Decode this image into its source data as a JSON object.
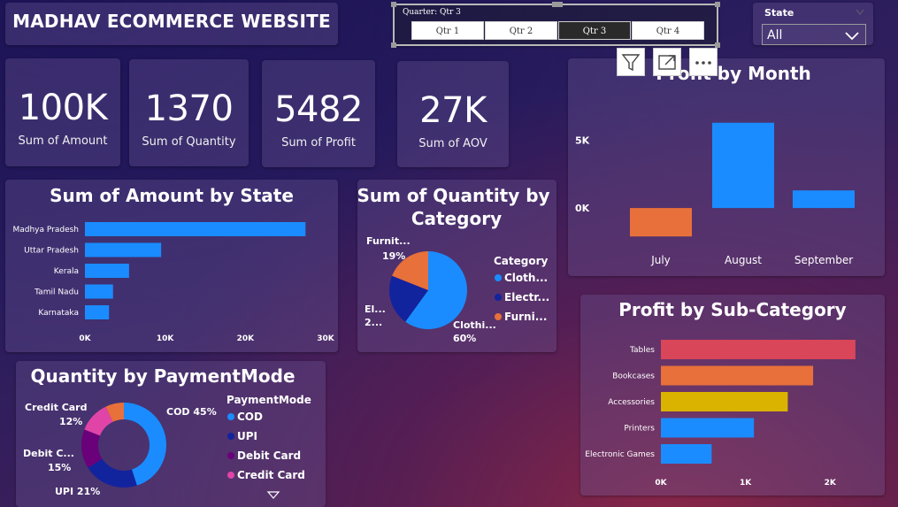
{
  "header": {
    "title": "MADHAV ECOMMERCE WEBSITE"
  },
  "quarter_slicer": {
    "label": "Quarter: Qtr 3",
    "options": [
      "Qtr 1",
      "Qtr 2",
      "Qtr 3",
      "Qtr 4"
    ],
    "selected": "Qtr 3"
  },
  "state_slicer": {
    "label": "State",
    "value": "All"
  },
  "kpis": [
    {
      "value": "100K",
      "label": "Sum of Amount"
    },
    {
      "value": "1370",
      "label": "Sum of Quantity"
    },
    {
      "value": "5482",
      "label": "Sum of Profit"
    },
    {
      "value": "27K",
      "label": "Sum of AOV"
    }
  ],
  "visual_icons": [
    "filter-icon",
    "focus-mode-icon",
    "more-options-icon"
  ],
  "colors": {
    "blue": "#1a8cff",
    "navy": "#12239e",
    "orange": "#e8703a",
    "purple": "#6b007b",
    "pink": "#e044a7",
    "red": "#d9465a",
    "gold": "#d9b300"
  },
  "chart_data": [
    {
      "id": "amount_by_state",
      "type": "bar",
      "orientation": "horizontal",
      "title": "Sum of Amount by State",
      "categories": [
        "Madhya Pradesh",
        "Uttar Pradesh",
        "Kerala",
        "Tamil Nadu",
        "Karnataka"
      ],
      "values": [
        27500,
        9500,
        5500,
        3500,
        3000
      ],
      "xlim": [
        0,
        30000
      ],
      "xticks": [
        "0K",
        "10K",
        "20K",
        "30K"
      ],
      "color": "#1a8cff"
    },
    {
      "id": "quantity_by_category",
      "type": "pie",
      "title": "Sum of Quantity by Category",
      "legend_title": "Category",
      "labels": [
        "Cloth...",
        "Electr...",
        "Furni..."
      ],
      "values": [
        60,
        21,
        19
      ],
      "slice_labels": [
        {
          "name": "Clothi...",
          "pct": "60%"
        },
        {
          "name": "El...",
          "pct": "2..."
        },
        {
          "name": "Furnit...",
          "pct": "19%"
        }
      ],
      "colors": [
        "#1a8cff",
        "#12239e",
        "#e8703a"
      ]
    },
    {
      "id": "quantity_by_paymentmode",
      "type": "pie",
      "variant": "donut",
      "title": "Quantity by PaymentMode",
      "legend_title": "PaymentMode",
      "labels": [
        "COD",
        "UPI",
        "Debit Card",
        "Credit Card"
      ],
      "values": [
        45,
        21,
        15,
        12
      ],
      "slice_labels": [
        {
          "name": "COD",
          "pct": "45%"
        },
        {
          "name": "UPI",
          "pct": "21%"
        },
        {
          "name": "Debit C...",
          "pct": "15%"
        },
        {
          "name": "Credit Card",
          "pct": "12%"
        }
      ],
      "colors": [
        "#1a8cff",
        "#12239e",
        "#6b007b",
        "#e044a7",
        "#e8703a"
      ],
      "extra_slice_value": 7
    },
    {
      "id": "profit_by_month",
      "type": "bar",
      "title": "Profit by Month",
      "categories": [
        "July",
        "August",
        "September"
      ],
      "values": [
        -2100,
        6300,
        1300
      ],
      "colors": [
        "#e8703a",
        "#1a8cff",
        "#1a8cff"
      ],
      "yticks": [
        "5K",
        "0K"
      ],
      "ylim": [
        -3000,
        7000
      ]
    },
    {
      "id": "profit_by_subcategory",
      "type": "bar",
      "orientation": "horizontal",
      "title": "Profit by Sub-Category",
      "categories": [
        "Tables",
        "Bookcases",
        "Accessories",
        "Printers",
        "Electronic Games"
      ],
      "values": [
        2300,
        1800,
        1500,
        1100,
        600
      ],
      "colors": [
        "#d9465a",
        "#e8703a",
        "#d9b300",
        "#1a8cff",
        "#1a8cff"
      ],
      "xlim": [
        0,
        2500
      ],
      "xticks": [
        "0K",
        "1K",
        "2K"
      ]
    }
  ]
}
